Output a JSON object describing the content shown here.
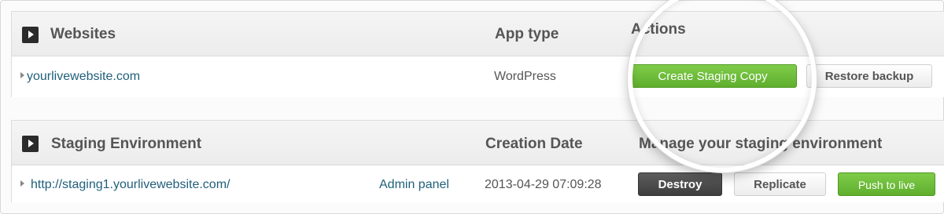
{
  "websites": {
    "header": "Websites",
    "app_type_header": "App type",
    "actions_header": "Actions",
    "row": {
      "url": "yourlivewebsite.com",
      "app_type": "WordPress",
      "create_staging_label": "Create Staging Copy",
      "restore_backup_label": "Restore backup"
    }
  },
  "staging": {
    "header": "Staging Environment",
    "creation_date_header": "Creation Date",
    "manage_header": "Manage your staging environment",
    "row": {
      "url": "http://staging1.yourlivewebsite.com/",
      "admin_link": "Admin panel",
      "creation_date": "2013-04-29 07:09:28",
      "destroy_label": "Destroy",
      "replicate_label": "Replicate",
      "push_label": "Push to live"
    }
  },
  "colors": {
    "green_button": "#6cbb38",
    "dark_button": "#4a4a4a",
    "link": "#1f5f7a"
  },
  "icons": [
    "play-icon",
    "caret-icon",
    "magnifier-lens"
  ]
}
